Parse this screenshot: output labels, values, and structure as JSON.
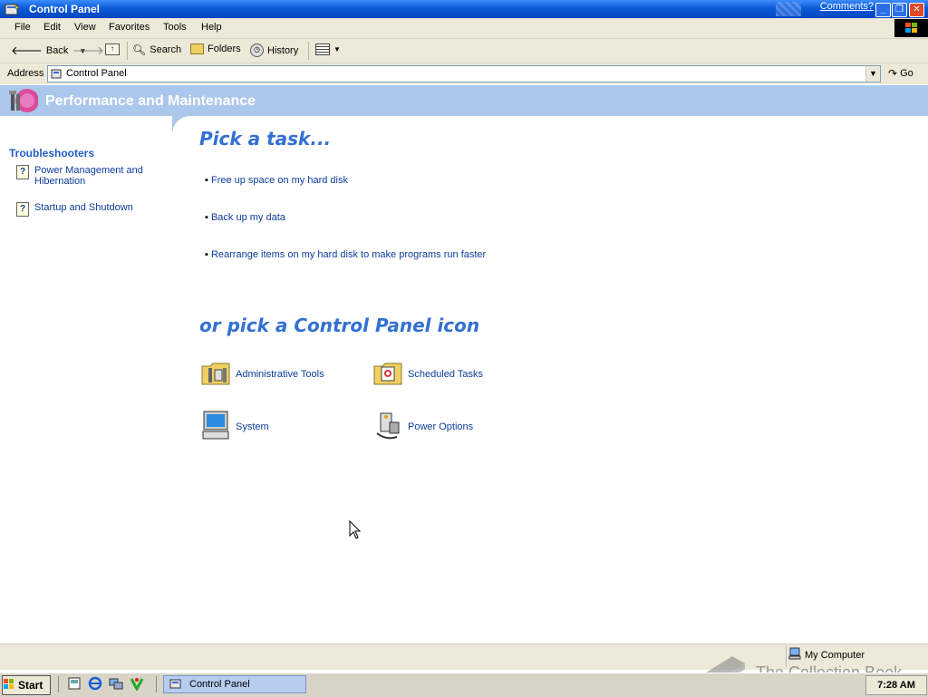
{
  "window": {
    "title": "Control Panel",
    "comments_link": "Comments?"
  },
  "menu": {
    "items": [
      "File",
      "Edit",
      "View",
      "Favorites",
      "Tools",
      "Help"
    ]
  },
  "toolbar": {
    "back": "Back",
    "search": "Search",
    "folders": "Folders",
    "history": "History"
  },
  "address": {
    "label": "Address",
    "value": "Control Panel",
    "go": "Go"
  },
  "header": {
    "title": "Performance and Maintenance"
  },
  "sidebar": {
    "troubleshooters_title": "Troubleshooters",
    "items": [
      {
        "label": "Power Management and Hibernation"
      },
      {
        "label": "Startup and Shutdown"
      }
    ]
  },
  "main": {
    "pick_task_title": "Pick a task...",
    "tasks": [
      {
        "label": "Free up space on my hard disk"
      },
      {
        "label": "Back up my data"
      },
      {
        "label": "Rearrange items on my hard disk to make programs run faster"
      }
    ],
    "pick_icon_title": "or pick a Control Panel icon",
    "icons": [
      {
        "label": "Administrative Tools",
        "icon": "admin-tools-icon"
      },
      {
        "label": "Scheduled Tasks",
        "icon": "scheduled-tasks-icon"
      },
      {
        "label": "System",
        "icon": "system-icon"
      },
      {
        "label": "Power Options",
        "icon": "power-options-icon"
      }
    ]
  },
  "statusbar": {
    "zone": "My Computer"
  },
  "taskbar": {
    "start": "Start",
    "active_window": "Control Panel",
    "clock": "7:28 AM"
  },
  "watermark": "The Collection Book"
}
